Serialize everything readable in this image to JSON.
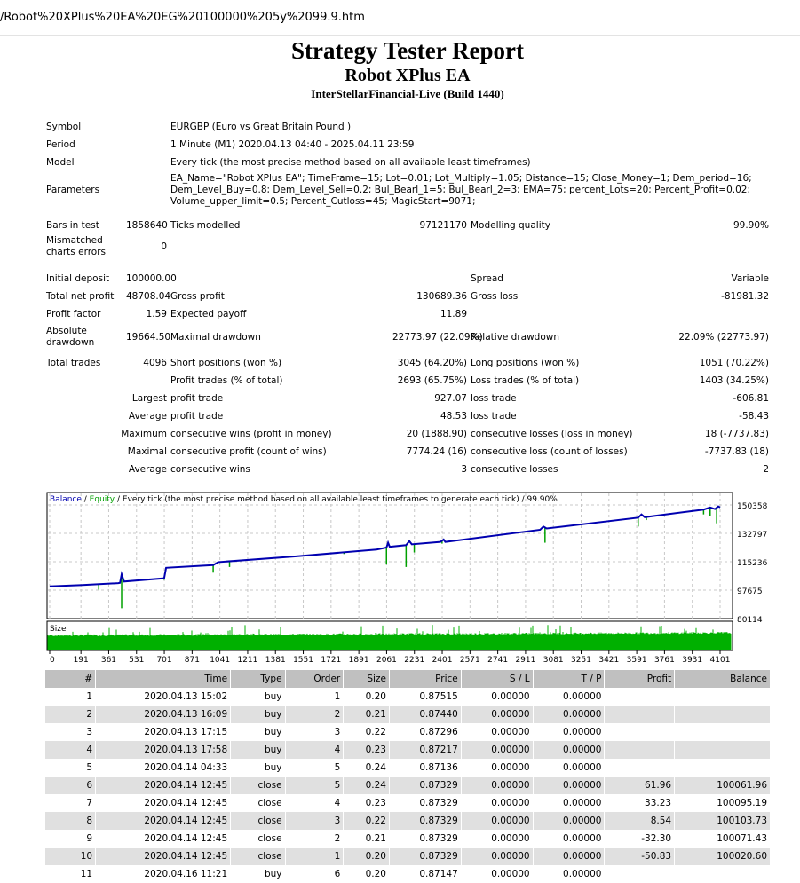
{
  "url": "/Robot%20XPlus%20EA%20EG%20100000%205y%2099.9.htm",
  "title": "Strategy Tester Report",
  "ea": "Robot XPlus EA",
  "server": "InterStellarFinancial-Live (Build 1440)",
  "info": {
    "symbol_label": "Symbol",
    "symbol": "EURGBP (Euro vs Great Britain Pound )",
    "period_label": "Period",
    "period": "1 Minute (M1) 2020.04.13 04:40 - 2025.04.11 23:59",
    "model_label": "Model",
    "model": "Every tick (the most precise method based on all available least timeframes)",
    "params_label": "Parameters",
    "params1": "EA_Name=\"Robot XPlus EA\"; TimeFrame=15; Lot=0.01; Lot_Multiply=1.05; Distance=15; Close_Money=1; Dem_period=16;",
    "params2": "Dem_Level_Buy=0.8; Dem_Level_Sell=0.2; Bul_Bearl_1=5; Bul_Bearl_2=3; EMA=75; percent_Lots=20; Percent_Profit=0.02;",
    "params3": "Volume_upper_limit=0.5; Percent_Cutloss=45; MagicStart=9071;"
  },
  "stats": {
    "bars_label": "Bars in test",
    "bars": "1858640",
    "ticks_label": "Ticks modelled",
    "ticks": "97121170",
    "quality_label": "Modelling quality",
    "quality": "99.90%",
    "mismatch_label1": "Mismatched",
    "mismatch_label2": "charts errors",
    "mismatch": "0",
    "deposit_label": "Initial deposit",
    "deposit": "100000.00",
    "spread_label": "Spread",
    "spread": "Variable",
    "netprofit_label": "Total net profit",
    "netprofit": "48708.04",
    "grossprofit_label": "Gross profit",
    "grossprofit": "130689.36",
    "grossloss_label": "Gross loss",
    "grossloss": "-81981.32",
    "pf_label": "Profit factor",
    "pf": "1.59",
    "payoff_label": "Expected payoff",
    "payoff": "11.89",
    "absdd_label1": "Absolute",
    "absdd_label2": "drawdown",
    "absdd": "19664.50",
    "maxdd_label": "Maximal drawdown",
    "maxdd": "22773.97 (22.09%)",
    "reldd_label": "Relative drawdown",
    "reldd": "22.09% (22773.97)",
    "trades_label": "Total trades",
    "trades": "4096",
    "short_label": "Short positions (won %)",
    "short": "3045 (64.20%)",
    "long_label": "Long positions (won %)",
    "long": "1051 (70.22%)",
    "pt_label": "Profit trades (% of total)",
    "pt": "2693 (65.75%)",
    "lt_label": "Loss trades (% of total)",
    "lt": "1403 (34.25%)",
    "largest": "Largest",
    "lpt_label": "profit trade",
    "lpt": "927.07",
    "llt_label": "loss trade",
    "llt": "-606.81",
    "average": "Average",
    "apt_label": "profit trade",
    "apt": "48.53",
    "alt_label": "loss trade",
    "alt": "-58.43",
    "maximum": "Maximum",
    "mcw_label": "consecutive wins (profit in money)",
    "mcw": "20 (1888.90)",
    "mcl_label": "consecutive losses (loss in money)",
    "mcl": "18 (-7737.83)",
    "maximal": "Maximal",
    "mcp_label": "consecutive profit (count of wins)",
    "mcp": "7774.24 (16)",
    "mclc_label": "consecutive loss (count of losses)",
    "mclc": "-7737.83 (18)",
    "average2": "Average",
    "acw_label": "consecutive wins",
    "acw": "3",
    "acl_label": "consecutive losses",
    "acl": "2"
  },
  "chart_data": {
    "type": "line",
    "legend_balance": "Balance",
    "legend_sep1": " / ",
    "legend_equity": "Equity",
    "legend_rest": " / Every tick (the most precise method based on all available least timeframes to generate each tick) / 99.90%",
    "size_label": "Size",
    "yticks": [
      "150358",
      "132797",
      "115236",
      "97675",
      "80114"
    ],
    "ylim": [
      80114,
      150358
    ],
    "xticks": [
      "0",
      "191",
      "361",
      "531",
      "701",
      "871",
      "1041",
      "1211",
      "1381",
      "1551",
      "1721",
      "1891",
      "2061",
      "2231",
      "2401",
      "2571",
      "2741",
      "2911",
      "3081",
      "3251",
      "3421",
      "3591",
      "3761",
      "3931",
      "4101"
    ],
    "xlim": [
      0,
      4101
    ],
    "colors": {
      "balance": "#0000b0",
      "equity": "#00a000",
      "size": "#00b000"
    },
    "balance": [
      [
        0,
        100000
      ],
      [
        200,
        100800
      ],
      [
        420,
        102000
      ],
      [
        430,
        102200
      ],
      [
        440,
        107500
      ],
      [
        455,
        103000
      ],
      [
        700,
        105000
      ],
      [
        712,
        111500
      ],
      [
        1000,
        113200
      ],
      [
        1030,
        115000
      ],
      [
        1500,
        118500
      ],
      [
        2000,
        122800
      ],
      [
        2060,
        124000
      ],
      [
        2070,
        127000
      ],
      [
        2080,
        124500
      ],
      [
        2180,
        125500
      ],
      [
        2200,
        128000
      ],
      [
        2215,
        126000
      ],
      [
        2390,
        127500
      ],
      [
        2410,
        129000
      ],
      [
        2420,
        127500
      ],
      [
        3000,
        135000
      ],
      [
        3020,
        137000
      ],
      [
        3040,
        135800
      ],
      [
        3600,
        142500
      ],
      [
        3620,
        144500
      ],
      [
        3640,
        142800
      ],
      [
        4000,
        147500
      ],
      [
        4040,
        148800
      ],
      [
        4070,
        147800
      ],
      [
        4090,
        149500
      ],
      [
        4101,
        148800
      ]
    ],
    "equity_dips": [
      [
        0,
        100000
      ],
      [
        300,
        98000
      ],
      [
        440,
        86500
      ],
      [
        700,
        104000
      ],
      [
        1000,
        108500
      ],
      [
        1100,
        112000
      ],
      [
        1800,
        120000
      ],
      [
        2060,
        113500
      ],
      [
        2180,
        112000
      ],
      [
        2230,
        121000
      ],
      [
        2400,
        126500
      ],
      [
        3030,
        127000
      ],
      [
        3600,
        137000
      ],
      [
        3650,
        141000
      ],
      [
        4000,
        144500
      ],
      [
        4040,
        143500
      ],
      [
        4080,
        139000
      ]
    ]
  },
  "table": {
    "headers": [
      "#",
      "Time",
      "Type",
      "Order",
      "Size",
      "Price",
      "S / L",
      "T / P",
      "Profit",
      "Balance"
    ],
    "rows": [
      [
        "1",
        "2020.04.13 15:02",
        "buy",
        "1",
        "0.20",
        "0.87515",
        "0.00000",
        "0.00000",
        "",
        ""
      ],
      [
        "2",
        "2020.04.13 16:09",
        "buy",
        "2",
        "0.21",
        "0.87440",
        "0.00000",
        "0.00000",
        "",
        ""
      ],
      [
        "3",
        "2020.04.13 17:15",
        "buy",
        "3",
        "0.22",
        "0.87296",
        "0.00000",
        "0.00000",
        "",
        ""
      ],
      [
        "4",
        "2020.04.13 17:58",
        "buy",
        "4",
        "0.23",
        "0.87217",
        "0.00000",
        "0.00000",
        "",
        ""
      ],
      [
        "5",
        "2020.04.14 04:33",
        "buy",
        "5",
        "0.24",
        "0.87136",
        "0.00000",
        "0.00000",
        "",
        ""
      ],
      [
        "6",
        "2020.04.14 12:45",
        "close",
        "5",
        "0.24",
        "0.87329",
        "0.00000",
        "0.00000",
        "61.96",
        "100061.96"
      ],
      [
        "7",
        "2020.04.14 12:45",
        "close",
        "4",
        "0.23",
        "0.87329",
        "0.00000",
        "0.00000",
        "33.23",
        "100095.19"
      ],
      [
        "8",
        "2020.04.14 12:45",
        "close",
        "3",
        "0.22",
        "0.87329",
        "0.00000",
        "0.00000",
        "8.54",
        "100103.73"
      ],
      [
        "9",
        "2020.04.14 12:45",
        "close",
        "2",
        "0.21",
        "0.87329",
        "0.00000",
        "0.00000",
        "-32.30",
        "100071.43"
      ],
      [
        "10",
        "2020.04.14 12:45",
        "close",
        "1",
        "0.20",
        "0.87329",
        "0.00000",
        "0.00000",
        "-50.83",
        "100020.60"
      ],
      [
        "11",
        "2020.04.16 11:21",
        "buy",
        "6",
        "0.20",
        "0.87147",
        "0.00000",
        "0.00000",
        "",
        ""
      ]
    ]
  }
}
